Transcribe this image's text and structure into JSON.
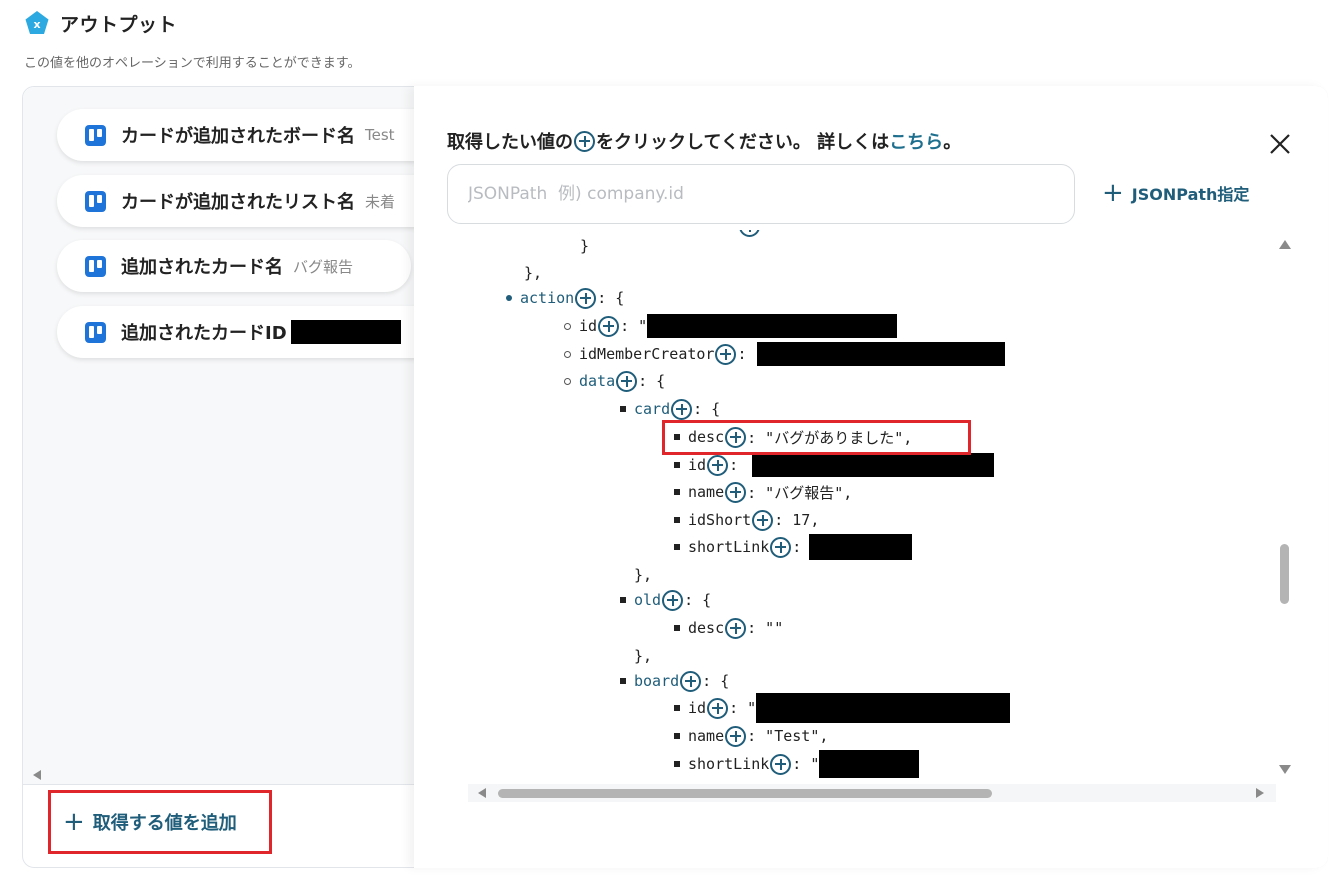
{
  "header": {
    "title": "アウトプット",
    "subtitle": "この値を他のオペレーションで利用することができます。"
  },
  "outputs": [
    {
      "label": "カードが追加されたボード名",
      "value": "Test",
      "redacted": false
    },
    {
      "label": "カードが追加されたリスト名",
      "value": "未着",
      "redacted": false
    },
    {
      "label": "追加されたカード名",
      "value": "バグ報告",
      "redacted": false
    },
    {
      "label": "追加されたカードID",
      "value": "",
      "redacted": true
    }
  ],
  "add_button": {
    "label": "取得する値を追加"
  },
  "dialog": {
    "instruction_before": "取得したい値の",
    "instruction_after": "をクリックしてください。 詳しくは",
    "instruction_link": "こちら",
    "instruction_end": "。",
    "search_placeholder": "JSONPath  例) company.id",
    "search_value": "",
    "jsonpath_button": "JSONPath指定"
  },
  "tree": {
    "close_brace": "}",
    "close_brace_comma": "},",
    "action_key": "action",
    "action_open": ": {",
    "id_key": "id",
    "id_sep": ": \"",
    "idMemberCreator_key": "idMemberCreator",
    "colon": ":",
    "data_key": "data",
    "card_key": "card",
    "card_fields": {
      "desc_key": "desc",
      "desc_value": ": \"バグがありました\",",
      "id_key": "id",
      "name_key": "name",
      "name_value": ": \"バグ報告\",",
      "idShort_key": "idShort",
      "idShort_value": ": 17,",
      "shortLink_key": "shortLink"
    },
    "old_key": "old",
    "old_desc_key": "desc",
    "old_desc_value": ": \"\"",
    "board_key": "board",
    "board_fields": {
      "id_key": "id",
      "id_sep": ": \"",
      "name_key": "name",
      "name_value": ": \"Test\",",
      "shortLink_key": "shortLink",
      "shortLink_sep": ": \""
    }
  },
  "colors": {
    "accent": "#1f5d7a",
    "link": "#1e6f8e",
    "highlight": "#e0262b",
    "trello": "#1f74d9"
  }
}
